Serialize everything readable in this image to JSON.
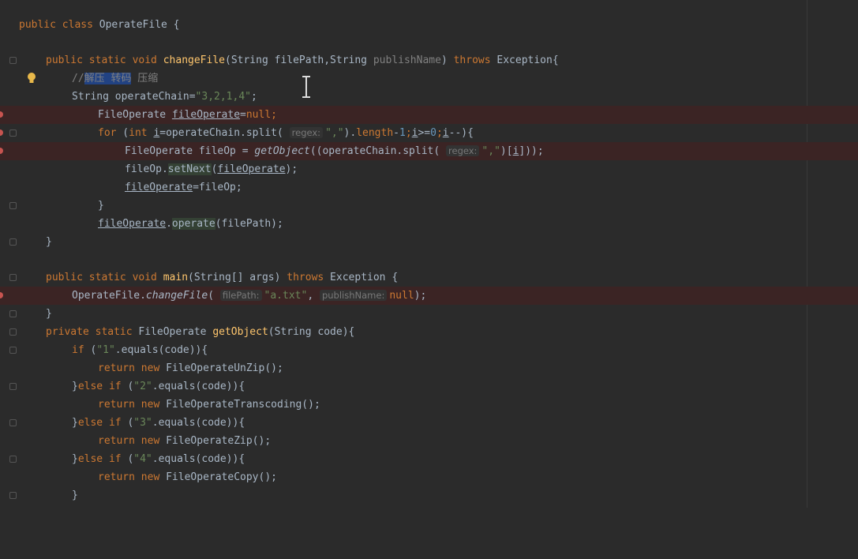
{
  "editor": {
    "lines": {
      "l1": {
        "a": "public class",
        "b": " OperateFile {"
      },
      "l2": {
        "a": "public static void",
        "fn": "changeFile",
        "b": "(String filePath,String ",
        "c": "publishName",
        "d": ") ",
        "e": "throws",
        "f": " Exception{"
      },
      "l3": {
        "a": "//",
        "sel": "解压 转码",
        "b": " 压缩"
      },
      "l4": {
        "a": "String operateChain=",
        "s": "\"3,2,1,4\"",
        "b": ";"
      },
      "l5": {
        "a": "FileOperate ",
        "fld": "fileOperate",
        "b": "=",
        "k": "null",
        "c": ";"
      },
      "l6": {
        "k1": "for",
        "a": " (",
        "k2": "int",
        "b": " ",
        "v1": "i",
        "c": "=operateChain.split( ",
        "h": "regex:",
        "s": "\",\"",
        "d": ").",
        "e": "length",
        "f": "-",
        "n1": "1",
        "g": ";",
        "v2": "i",
        "i": ">=",
        "n2": "0",
        "j": ";",
        "v3": "i",
        "k": "--){"
      },
      "l7": {
        "a": "FileOperate fileOp = ",
        "m": "getObject",
        "b": "((operateChain.split( ",
        "h": "regex:",
        "s": "\",\"",
        "c": ")[",
        "v": "i",
        "d": "]));"
      },
      "l8": {
        "a": "fileOp.",
        "m": "setNext",
        "b": "(",
        "fld": "fileOperate",
        "c": ");"
      },
      "l9": {
        "fld": "fileOperate",
        "a": "=fileOp;"
      },
      "l10": {
        "a": "}"
      },
      "l11": {
        "fld": "fileOperate",
        "a": ".",
        "m": "operate",
        "b": "(filePath);"
      },
      "l12": {
        "a": "}"
      },
      "l13": {
        "a": "public static void",
        "fn": "main",
        "b": "(String[] args) ",
        "c": "throws",
        "d": " Exception {"
      },
      "l14": {
        "a": "OperateFile.",
        "m": "changeFile",
        "b": "( ",
        "h1": "filePath:",
        "s": "\"a.txt\"",
        "c": ", ",
        "h2": "publishName:",
        "k": "null",
        "d": ");"
      },
      "l15": {
        "a": "}"
      },
      "l16": {
        "a": "private static",
        "b": " FileOperate ",
        "fn": "getObject",
        "c": "(String code){"
      },
      "l17": {
        "k": "if",
        "a": " (",
        "s": "\"1\"",
        "b": ".equals(code)){"
      },
      "l18": {
        "k1": "return",
        "a": " ",
        "k2": "new",
        "b": " FileOperateUnZip();"
      },
      "l19": {
        "a": "}",
        "k1": "else",
        "b": " ",
        "k2": "if",
        "c": " (",
        "s": "\"2\"",
        "d": ".equals(code)){"
      },
      "l20": {
        "k1": "return",
        "a": " ",
        "k2": "new",
        "b": " FileOperateTranscoding();"
      },
      "l21": {
        "a": "}",
        "k1": "else",
        "b": " ",
        "k2": "if",
        "c": " (",
        "s": "\"3\"",
        "d": ".equals(code)){"
      },
      "l22": {
        "k1": "return",
        "a": " ",
        "k2": "new",
        "b": " FileOperateZip();"
      },
      "l23": {
        "a": "}",
        "k1": "else",
        "b": " ",
        "k2": "if",
        "c": " (",
        "s": "\"4\"",
        "d": ".equals(code)){"
      },
      "l24": {
        "k1": "return",
        "a": " ",
        "k2": "new",
        "b": " FileOperateCopy();"
      },
      "l25": {
        "a": "}"
      }
    }
  }
}
